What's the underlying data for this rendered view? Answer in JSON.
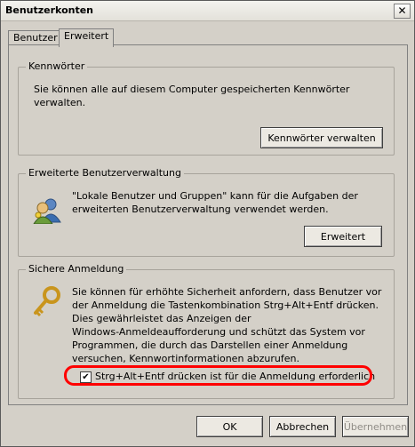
{
  "window": {
    "title": "Benutzerkonten",
    "close_glyph": "✕"
  },
  "tabs": [
    {
      "label": "Benutzer"
    },
    {
      "label": "Erweitert"
    }
  ],
  "passwords": {
    "title": "Kennwörter",
    "text_line1": "Sie können alle auf diesem Computer gespeicherten Kennwörter",
    "text_line2": "verwalten.",
    "button": "Kennwörter verwalten"
  },
  "advanced": {
    "title": "Erweiterte Benutzerverwaltung",
    "text_line1": "\"Lokale Benutzer und Gruppen\" kann für die Aufgaben der",
    "text_line2": "erweiterten Benutzerverwaltung verwendet werden.",
    "button": "Erweitert"
  },
  "secure_logon": {
    "title": "Sichere Anmeldung",
    "lines": [
      "Sie können für erhöhte Sicherheit anfordern, dass Benutzer vor",
      "der Anmeldung die Tastenkombination Strg+Alt+Entf drücken.",
      "Dies gewährleistet das Anzeigen der",
      "Windows-Anmeldeaufforderung und schützt das System vor",
      "Programmen, die durch das Darstellen einer Anmeldung",
      "versuchen, Kennwortinformationen abzurufen."
    ],
    "checkbox_label": "Strg+Alt+Entf drücken ist für die Anmeldung erforderlich",
    "checkbox_checked": true,
    "check_glyph": "✔"
  },
  "footer": {
    "ok": "OK",
    "cancel": "Abbrechen",
    "apply": "Übernehmen"
  },
  "colors": {
    "highlight": "#ff0000",
    "disabled_text": "#8f8c86"
  }
}
